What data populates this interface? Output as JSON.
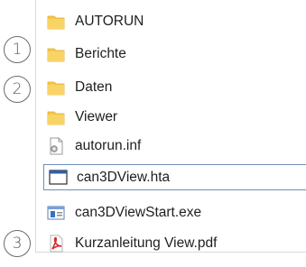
{
  "files": [
    {
      "name": "AUTORUN",
      "icon": "folder-icon"
    },
    {
      "name": "Berichte",
      "icon": "folder-icon"
    },
    {
      "name": "Daten",
      "icon": "folder-icon"
    },
    {
      "name": "Viewer",
      "icon": "folder-icon"
    },
    {
      "name": "autorun.inf",
      "icon": "settings-file-icon"
    },
    {
      "name": "can3DView.hta",
      "icon": "hta-window-icon",
      "selected": true
    },
    {
      "name": "can3DViewStart.exe",
      "icon": "exe-app-icon"
    },
    {
      "name": "Kurzanleitung View.pdf",
      "icon": "pdf-icon"
    }
  ],
  "callouts": [
    {
      "number": "1",
      "row": "Berichte"
    },
    {
      "number": "2",
      "row": "Daten"
    },
    {
      "number": "3",
      "row": "Kurzanleitung View.pdf"
    }
  ],
  "colors": {
    "folder": "#f5c84a",
    "folder_tab": "#e8b231",
    "selection_border": "#6e8fb8",
    "pdf_red": "#d42a2a"
  }
}
